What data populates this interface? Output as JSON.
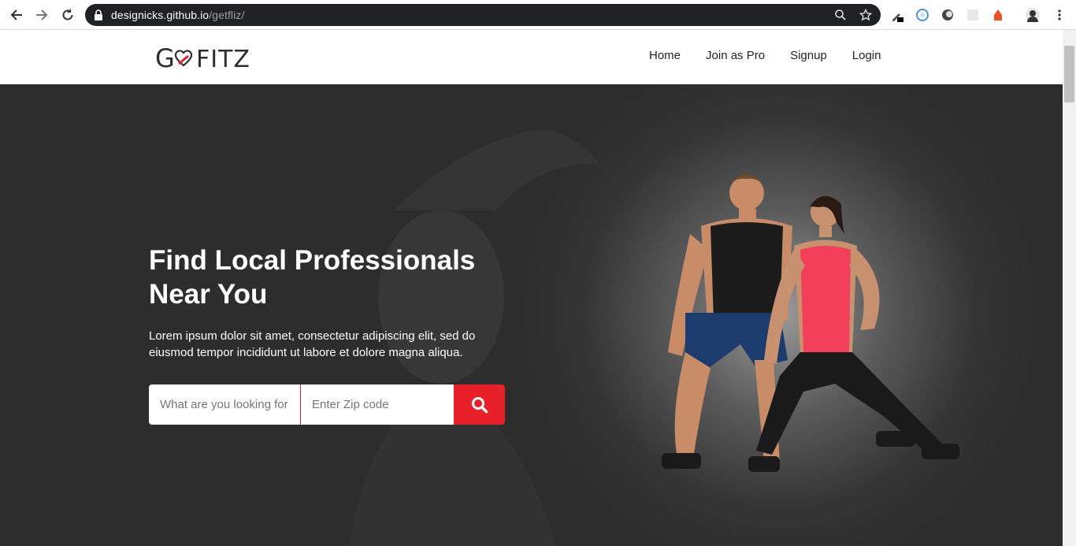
{
  "browser": {
    "url_host": "designicks.github.io",
    "url_path": "/getfliz/"
  },
  "site": {
    "logo_text": "GOFITZ",
    "nav": [
      {
        "label": "Home"
      },
      {
        "label": "Join as Pro"
      },
      {
        "label": "Signup"
      },
      {
        "label": "Login"
      }
    ]
  },
  "hero": {
    "title": "Find Local Professionals Near You",
    "description": "Lorem ipsum dolor sit amet, consectetur adipiscing elit, sed do eiusmod tempor incididunt ut labore et dolore magna aliqua.",
    "search_placeholder": "What are you looking for",
    "zip_placeholder": "Enter Zip code"
  },
  "colors": {
    "accent": "#e8202a",
    "hero_background": "#2d2d2d"
  }
}
